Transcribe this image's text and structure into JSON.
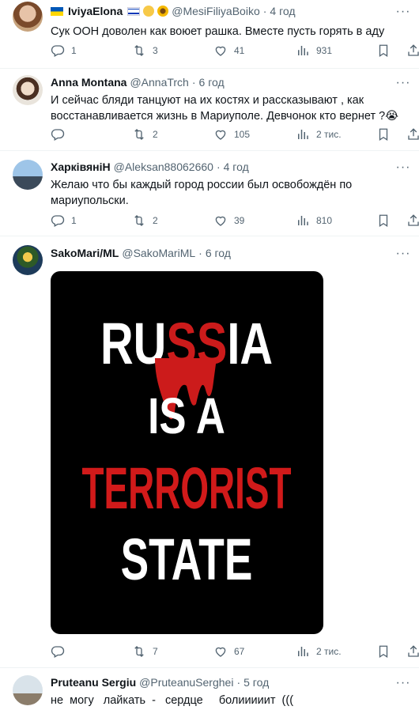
{
  "tweets": [
    {
      "name": "IviyaElona",
      "handle": "@MesiFiliyaBoiko",
      "time": "4 год",
      "text": "Сук ООН доволен как воюет рашка. Вместе пусть горять в аду",
      "replies": "1",
      "retweets": "3",
      "likes": "41",
      "views": "931"
    },
    {
      "name": "Anna Montana",
      "handle": "@AnnaTrch",
      "time": "6 год",
      "text": "И сейчас бляди танцуют на их костях и рассказывают , как восстанавливается жизнь в Мариуполе. Девчонок кто вернет ?😭",
      "replies": "",
      "retweets": "2",
      "likes": "105",
      "views": "2 тис."
    },
    {
      "name": "ХарківяніН",
      "handle": "@Aleksan88062660",
      "time": "4 год",
      "text": "Желаю что бы каждый город россии был освобождён по мариупольски.",
      "replies": "1",
      "retweets": "2",
      "likes": "39",
      "views": "810"
    },
    {
      "name": "SakoMari/ML",
      "handle": "@SakoMariML",
      "time": "6 год",
      "poster": {
        "line1a": "RU",
        "line1b": "SS",
        "line1c": "IA",
        "line2": "IS A",
        "line3": "TERRORIST",
        "line4": "STATE"
      },
      "replies": "",
      "retweets": "7",
      "likes": "67",
      "views": "2 тис."
    },
    {
      "name": "Pruteanu Sergiu",
      "handle": "@PruteanuSerghei",
      "time": "5 год",
      "text": "не  могу   лайкать  -   сердце     болииииит  ((("
    }
  ],
  "sep": "·",
  "more_glyph": "···",
  "colors": {
    "meta": "#536471",
    "border": "#eff3f4",
    "blood": "#d11a1a"
  },
  "icons": [
    "reply-icon",
    "retweet-icon",
    "like-icon",
    "views-icon",
    "bookmark-icon",
    "share-icon",
    "more-icon"
  ]
}
